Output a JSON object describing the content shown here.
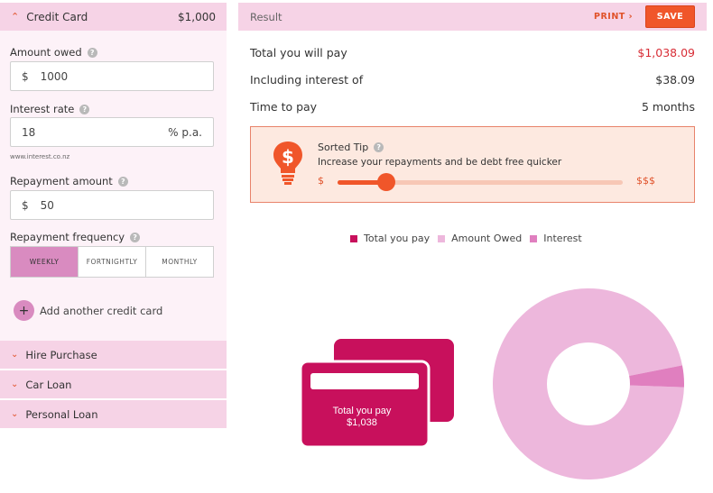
{
  "colors": {
    "accent": "#f0562a",
    "header_bg": "#f6d3e6",
    "total_pay": "#c8105c",
    "amount_owed": "#edb7dc",
    "interest": "#e07fbf"
  },
  "credit_card": {
    "title": "Credit Card",
    "amount": "$1,000",
    "amount_owed_label": "Amount owed",
    "amount_owed_prefix": "$",
    "amount_owed_value": "1000",
    "interest_rate_label": "Interest rate",
    "interest_rate_value": "18",
    "interest_rate_suffix": "% p.a.",
    "source": "www.interest.co.nz",
    "repayment_label": "Repayment amount",
    "repayment_prefix": "$",
    "repayment_value": "50",
    "frequency_label": "Repayment frequency",
    "frequency_options": [
      "WEEKLY",
      "FORTNIGHTLY",
      "MONTHLY"
    ],
    "frequency_selected": "WEEKLY",
    "add_card": "Add another credit card"
  },
  "accordions": [
    "Hire Purchase",
    "Car Loan",
    "Personal Loan"
  ],
  "result": {
    "title": "Result",
    "print": "PRINT",
    "save": "SAVE",
    "total_label": "Total you will pay",
    "total_value": "$1,038.09",
    "interest_label": "Including interest of",
    "interest_value": "$38.09",
    "time_label": "Time to pay",
    "time_value": "5 months"
  },
  "tip": {
    "title": "Sorted Tip",
    "text": "Increase your repayments and be debt free quicker",
    "slider_min": "$",
    "slider_max": "$$$",
    "slider_level": 0.17
  },
  "legend": [
    "Total you pay",
    "Amount Owed",
    "Interest"
  ],
  "card_graphic": {
    "label": "Total you pay",
    "value": "$1,038"
  },
  "donut": {
    "amount_owed": 1000,
    "interest": 38.09
  }
}
